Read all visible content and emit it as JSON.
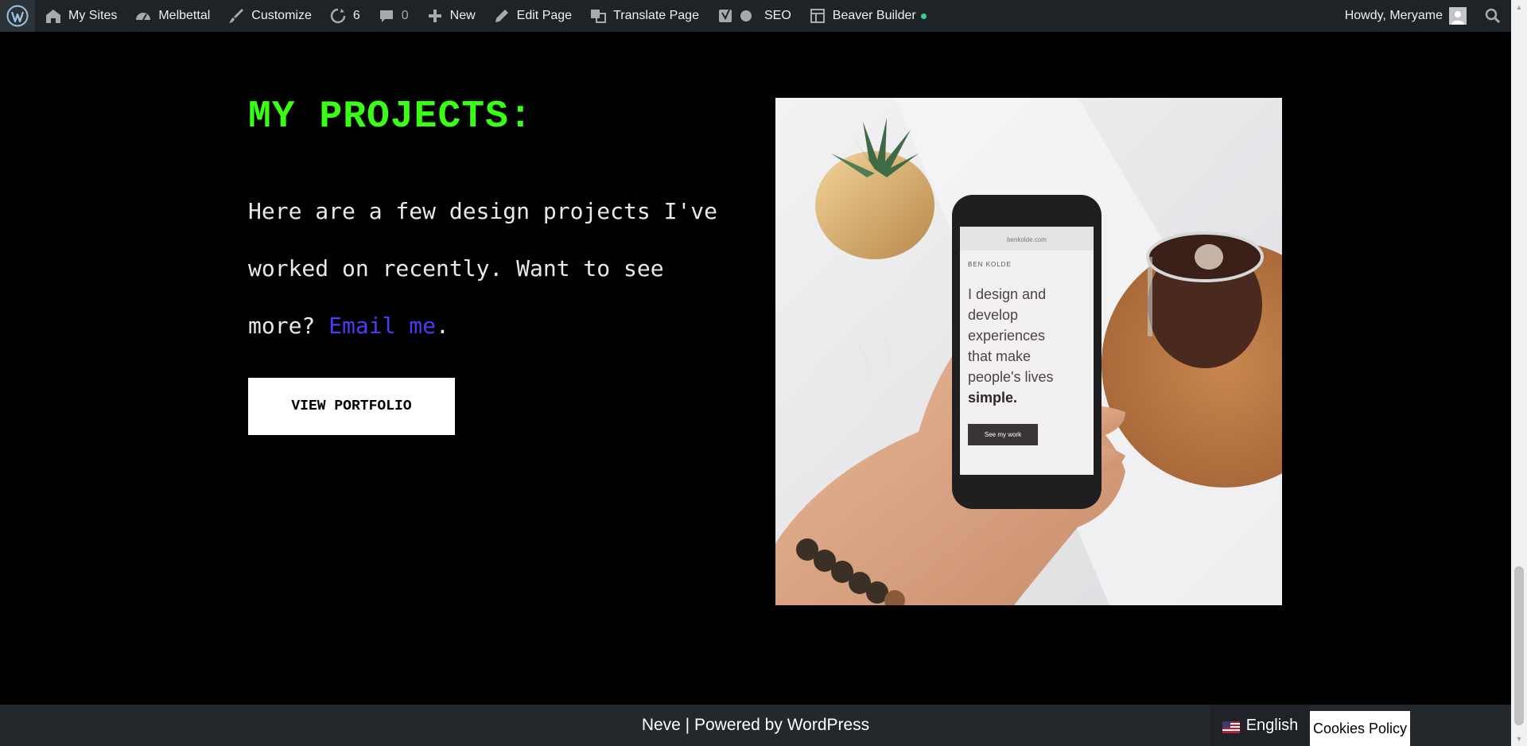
{
  "adminbar": {
    "my_sites": "My Sites",
    "site_name": "Melbettal",
    "customize": "Customize",
    "updates_count": "6",
    "comments_count": "0",
    "new": "New",
    "edit_page": "Edit Page",
    "translate_page": "Translate Page",
    "seo": "SEO",
    "beaver_builder": "Beaver Builder",
    "howdy": "Howdy, Meryame"
  },
  "main": {
    "heading": "MY PROJECTS:",
    "paragraph_text": "Here are a few design projects I've worked on recently. Want to see more? ",
    "email_link": "Email me",
    "paragraph_end": ".",
    "button_label": "VIEW PORTFOLIO"
  },
  "phone_screen": {
    "url": "benkolde.com",
    "brand": "BEN KOLDE",
    "tagline_1": "I design and",
    "tagline_2": "develop",
    "tagline_3": "experiences",
    "tagline_4": "that make",
    "tagline_5": "people's lives",
    "tagline_6": "simple.",
    "cta": "See my work"
  },
  "footer": {
    "theme_link": "Neve",
    "separator": " | ",
    "powered_prefix": "Powered by ",
    "wordpress_link": "WordPress",
    "language": "English",
    "cookies": "Cookies Policy"
  },
  "colors": {
    "heading": "#39ff14",
    "link": "#4a3cf7",
    "adminbar_bg": "#1d2327",
    "footer_bg": "#23282d"
  }
}
